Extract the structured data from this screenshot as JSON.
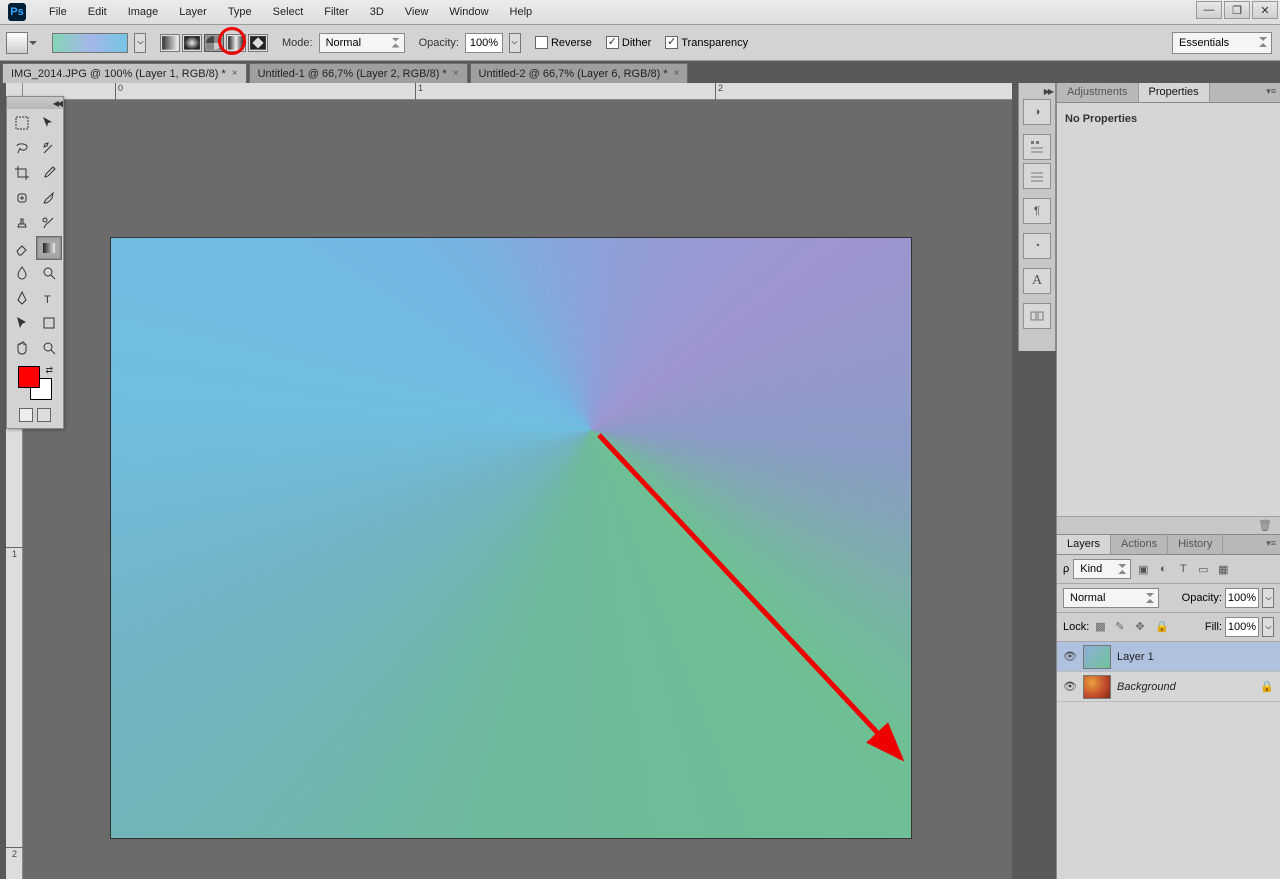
{
  "menubar": {
    "items": [
      "File",
      "Edit",
      "Image",
      "Layer",
      "Type",
      "Select",
      "Filter",
      "3D",
      "View",
      "Window",
      "Help"
    ]
  },
  "options": {
    "mode_label": "Mode:",
    "mode_value": "Normal",
    "opacity_label": "Opacity:",
    "opacity_value": "100%",
    "reverse_label": "Reverse",
    "dither_label": "Dither",
    "transparency_label": "Transparency",
    "workspace": "Essentials"
  },
  "tabs": [
    {
      "title": "IMG_2014.JPG @ 100% (Layer 1, RGB/8) *",
      "active": true
    },
    {
      "title": "Untitled-1 @ 66,7% (Layer 2, RGB/8) *",
      "active": false
    },
    {
      "title": "Untitled-2 @ 66,7% (Layer 6, RGB/8) *",
      "active": false
    }
  ],
  "ruler": {
    "h": [
      "0",
      "1",
      "2"
    ],
    "v": [
      "1",
      "2"
    ]
  },
  "right_tabs_top": {
    "adjustments": "Adjustments",
    "properties": "Properties"
  },
  "properties_body": "No Properties",
  "layers_panel": {
    "tabs": [
      "Layers",
      "Actions",
      "History"
    ],
    "kind_label": "Kind",
    "blend_value": "Normal",
    "opacity_label": "Opacity:",
    "opacity_value": "100%",
    "lock_label": "Lock:",
    "fill_label": "Fill:",
    "fill_value": "100%",
    "layers": [
      {
        "name": "Layer 1",
        "selected": true,
        "locked": false,
        "thumb": "grad"
      },
      {
        "name": "Background",
        "selected": false,
        "locked": true,
        "thumb": "img"
      }
    ]
  }
}
